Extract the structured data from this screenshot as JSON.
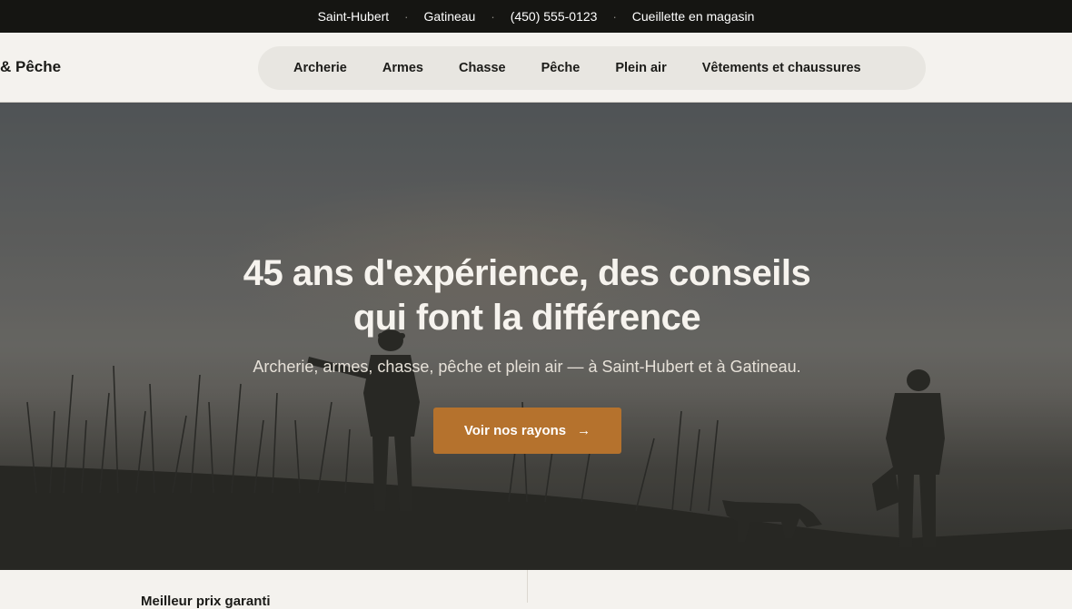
{
  "topbar": {
    "items": [
      "Saint-Hubert",
      "Gatineau",
      "(450) 555-0123",
      "Cueillette en magasin"
    ],
    "separator": "·"
  },
  "header": {
    "brand": "& Pêche",
    "nav": [
      "Archerie",
      "Armes",
      "Chasse",
      "Pêche",
      "Plein air",
      "Vêtements et chaussures"
    ]
  },
  "hero": {
    "title_line1": "45 ans d'expérience, des conseils",
    "title_line2": "qui font la différence",
    "subtitle": "Archerie, armes, chasse, pêche et plein air — à Saint-Hubert et à Gatineau.",
    "cta_label": "Voir nos rayons",
    "cta_arrow": "→",
    "image_subject": "hunters-with-dog-silhouette-in-fog"
  },
  "features": {
    "first_title": "Meilleur prix garanti"
  },
  "colors": {
    "topbar_bg": "#151512",
    "page_bg": "#f4f2ee",
    "nav_pill_bg": "#e8e6e1",
    "accent": "#b5722d"
  }
}
